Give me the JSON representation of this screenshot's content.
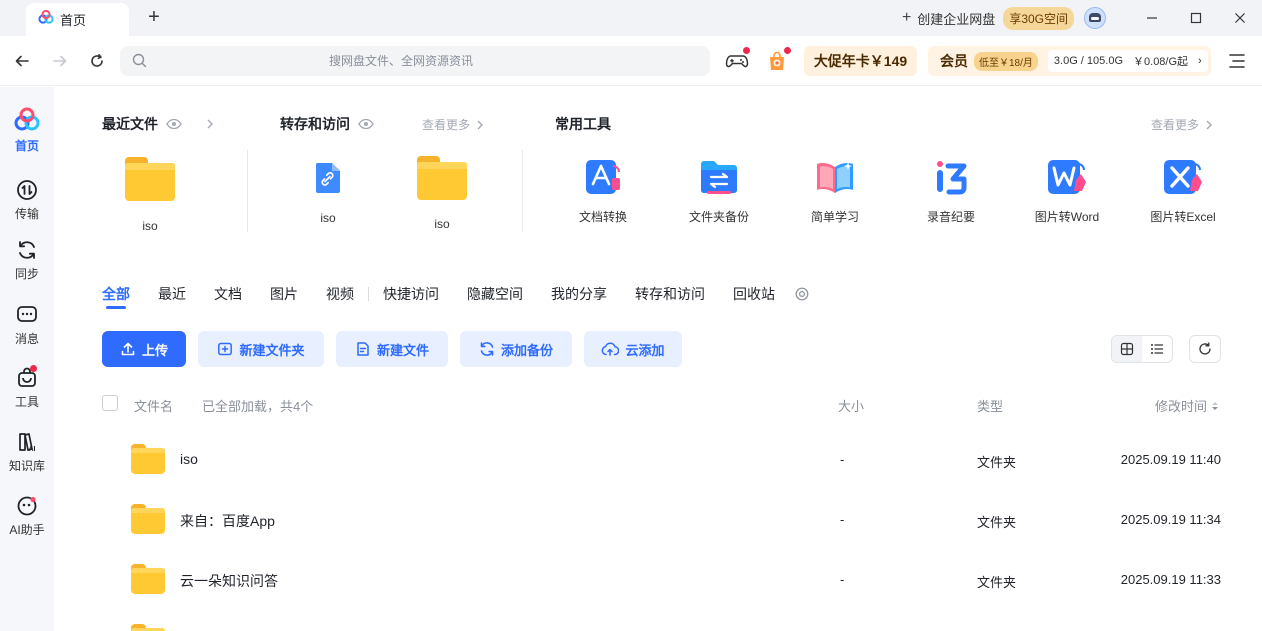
{
  "titlebar": {
    "tab_label": "首页",
    "new_tab": "+",
    "create_enterprise": "创建企业网盘",
    "space_badge": "享30G空间"
  },
  "navbar": {
    "search_placeholder": "搜网盘文件、全网资源资讯",
    "promo_label": "大促年卡￥149",
    "vip_label": "会员",
    "vip_badge": "低至￥18/月",
    "storage_usage": "3.0G / 105.0G",
    "storage_price": "￥0.08/G起",
    "storage_chevron": "›"
  },
  "sidebar": {
    "items": [
      {
        "label": "首页",
        "icon": "home-icon"
      },
      {
        "label": "传输",
        "icon": "transfer-icon"
      },
      {
        "label": "同步",
        "icon": "sync-icon"
      },
      {
        "label": "消息",
        "icon": "message-icon"
      },
      {
        "label": "工具",
        "icon": "toolbox-icon"
      },
      {
        "label": "知识库",
        "icon": "knowledge-base-icon"
      },
      {
        "label": "AI助手",
        "icon": "ai-assistant-icon"
      }
    ]
  },
  "recent": {
    "title": "最近文件",
    "items": [
      {
        "label": "iso"
      }
    ]
  },
  "saved": {
    "title": "转存和访问",
    "more": "查看更多",
    "items": [
      {
        "label": "iso"
      },
      {
        "label": "iso"
      }
    ]
  },
  "tools": {
    "title": "常用工具",
    "more": "查看更多",
    "items": [
      {
        "label": "文档转换",
        "icon": "pdf-convert-icon"
      },
      {
        "label": "文件夹备份",
        "icon": "folder-backup-icon"
      },
      {
        "label": "简单学习",
        "icon": "open-book-icon"
      },
      {
        "label": "录音纪要",
        "icon": "recording-notes-icon"
      },
      {
        "label": "图片转Word",
        "icon": "image-to-word-icon"
      },
      {
        "label": "图片转Excel",
        "icon": "image-to-excel-icon"
      }
    ]
  },
  "file_tabs": [
    {
      "label": "全部",
      "active": true
    },
    {
      "label": "最近"
    },
    {
      "label": "文档"
    },
    {
      "label": "图片"
    },
    {
      "label": "视频"
    },
    {
      "label": "快捷访问"
    },
    {
      "label": "隐藏空间"
    },
    {
      "label": "我的分享"
    },
    {
      "label": "转存和访问"
    },
    {
      "label": "回收站"
    }
  ],
  "actions": {
    "upload": "上传",
    "new_folder": "新建文件夹",
    "new_file": "新建文件",
    "add_backup": "添加备份",
    "cloud_add": "云添加"
  },
  "list": {
    "col_name": "文件名",
    "loaded_status": "已全部加载，共4个",
    "col_size": "大小",
    "col_type": "类型",
    "col_modified": "修改时间",
    "rows": [
      {
        "name": "iso",
        "size": "-",
        "type": "文件夹",
        "modified": "2025.09.19 11:40"
      },
      {
        "name": "来自：百度App",
        "size": "-",
        "type": "文件夹",
        "modified": "2025.09.19 11:34"
      },
      {
        "name": "云一朵知识问答",
        "size": "-",
        "type": "文件夹",
        "modified": "2025.09.19 11:33"
      }
    ]
  },
  "colors": {
    "accent": "#2f6bff",
    "folder": "#ffc933",
    "promo_bg": "#fff1dd"
  }
}
